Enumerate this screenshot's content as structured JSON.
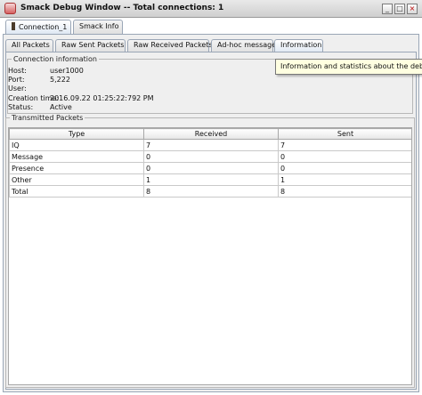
{
  "window": {
    "title": "Smack Debug Window -- Total connections: 1",
    "buttons": [
      "_",
      "□",
      "×"
    ]
  },
  "outer_tabs": [
    {
      "label": "Connection_1",
      "selected": true
    },
    {
      "label": "Smack Info",
      "selected": false
    }
  ],
  "inner_tabs": [
    {
      "label": "All Packets",
      "selected": false
    },
    {
      "label": "Raw Sent Packets",
      "selected": false
    },
    {
      "label": "Raw Received Packets",
      "selected": false
    },
    {
      "label": "Ad-hoc message",
      "selected": false
    },
    {
      "label": "Information",
      "selected": true
    }
  ],
  "connection_info": {
    "legend": "Connection information",
    "rows": [
      {
        "key": "Host:",
        "value": "user1000"
      },
      {
        "key": "Port:",
        "value": "5,222"
      },
      {
        "key": "User:",
        "value": ""
      },
      {
        "key": "Creation time:",
        "value": "2016.09.22 01:25:22:792 PM"
      },
      {
        "key": "Status:",
        "value": "Active"
      }
    ]
  },
  "transmitted_packets": {
    "legend": "Transmitted Packets",
    "columns": [
      "Type",
      "Received",
      "Sent"
    ],
    "rows": [
      [
        "IQ",
        "7",
        "7"
      ],
      [
        "Message",
        "0",
        "0"
      ],
      [
        "Presence",
        "0",
        "0"
      ],
      [
        "Other",
        "1",
        "1"
      ],
      [
        "Total",
        "8",
        "8"
      ]
    ]
  },
  "tooltip": {
    "text": "Information and statistics about the debugged c"
  }
}
